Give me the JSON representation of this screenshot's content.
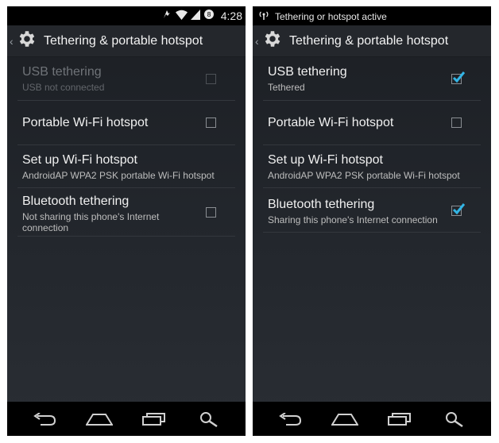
{
  "left": {
    "status": {
      "time": "4:28"
    },
    "actionbar": {
      "title": "Tethering & portable hotspot"
    },
    "items": [
      {
        "title": "USB tethering",
        "summary": "USB not connected",
        "checked": false,
        "enabled": false
      },
      {
        "title": "Portable Wi-Fi hotspot",
        "summary": "",
        "checked": false,
        "enabled": true
      },
      {
        "title": "Set up Wi-Fi hotspot",
        "summary": "AndroidAP WPA2 PSK portable Wi-Fi hotspot",
        "checked": null,
        "enabled": true
      },
      {
        "title": "Bluetooth tethering",
        "summary": "Not sharing this phone's Internet connection",
        "checked": false,
        "enabled": true
      }
    ]
  },
  "right": {
    "status": {
      "notification": "Tethering or hotspot active"
    },
    "actionbar": {
      "title": "Tethering & portable hotspot"
    },
    "items": [
      {
        "title": "USB tethering",
        "summary": "Tethered",
        "checked": true,
        "enabled": true
      },
      {
        "title": "Portable Wi-Fi hotspot",
        "summary": "",
        "checked": false,
        "enabled": true
      },
      {
        "title": "Set up Wi-Fi hotspot",
        "summary": "AndroidAP WPA2 PSK portable Wi-Fi hotspot",
        "checked": null,
        "enabled": true
      },
      {
        "title": "Bluetooth tethering",
        "summary": "Sharing this phone's Internet connection",
        "checked": true,
        "enabled": true
      }
    ]
  },
  "colors": {
    "checkmark": "#33b5e5",
    "background": "#1f2227",
    "statusbar": "#000000"
  },
  "icons": [
    "settings-gear-icon",
    "back-icon",
    "home-icon",
    "recent-apps-icon",
    "search-icon",
    "wifi-icon",
    "signal-icon",
    "alarm-icon",
    "hotspot-icon"
  ]
}
